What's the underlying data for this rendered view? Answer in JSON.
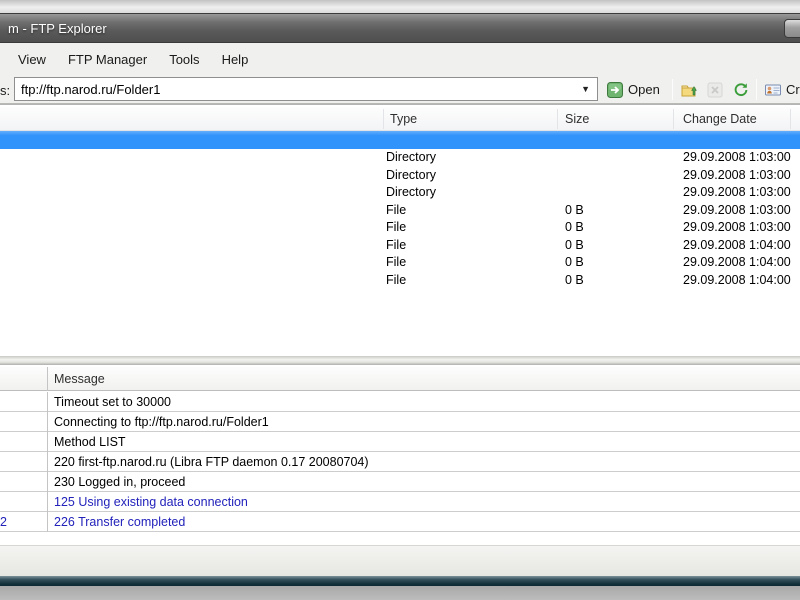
{
  "window": {
    "title_visible": "m - FTP Explorer"
  },
  "menu": {
    "items": [
      "View",
      "FTP Manager",
      "Tools",
      "Help"
    ]
  },
  "toolbar": {
    "address_label_visible": "s:",
    "address_value": "ftp://ftp.narod.ru/Folder1",
    "open_label": "Open",
    "create_label_visible": "Cr",
    "icons": [
      "dropdown-arrow",
      "open-arrow",
      "folder-up",
      "cancel",
      "refresh",
      "contact-card"
    ]
  },
  "file_list": {
    "columns": [
      "Type",
      "Size",
      "Change Date"
    ],
    "rows": [
      {
        "type": "",
        "size": "",
        "date": "",
        "selected": true
      },
      {
        "type": "Directory",
        "size": "",
        "date": "29.09.2008 1:03:00"
      },
      {
        "type": "Directory",
        "size": "",
        "date": "29.09.2008 1:03:00"
      },
      {
        "type": "Directory",
        "size": "",
        "date": "29.09.2008 1:03:00"
      },
      {
        "type": "File",
        "size": "0 B",
        "date": "29.09.2008 1:03:00"
      },
      {
        "type": "File",
        "size": "0 B",
        "date": "29.09.2008 1:03:00"
      },
      {
        "type": "File",
        "size": "0 B",
        "date": "29.09.2008 1:04:00"
      },
      {
        "type": "File",
        "size": "0 B",
        "date": "29.09.2008 1:04:00"
      },
      {
        "type": "File",
        "size": "0 B",
        "date": "29.09.2008 1:04:00"
      }
    ]
  },
  "log": {
    "column_header": "Message",
    "rows": [
      {
        "fragment": "",
        "message": "Timeout set to 30000",
        "blue": false
      },
      {
        "fragment": "",
        "message": "Connecting to ftp://ftp.narod.ru/Folder1",
        "blue": false
      },
      {
        "fragment": "",
        "message": "Method LIST",
        "blue": false
      },
      {
        "fragment": "",
        "message": "220 first-ftp.narod.ru (Libra FTP daemon 0.17 20080704)",
        "blue": false
      },
      {
        "fragment": "",
        "message": "230 Logged in, proceed",
        "blue": false
      },
      {
        "fragment": "",
        "message": "125 Using existing data connection",
        "blue": true
      },
      {
        "fragment": "2",
        "message": "226 Transfer completed",
        "blue": true
      }
    ]
  },
  "colors": {
    "selection": "#3093fb",
    "log_link_blue": "#2222bb",
    "titlebar_gray": "#5f5f5f",
    "window_bottom_teal": "#12303a"
  }
}
